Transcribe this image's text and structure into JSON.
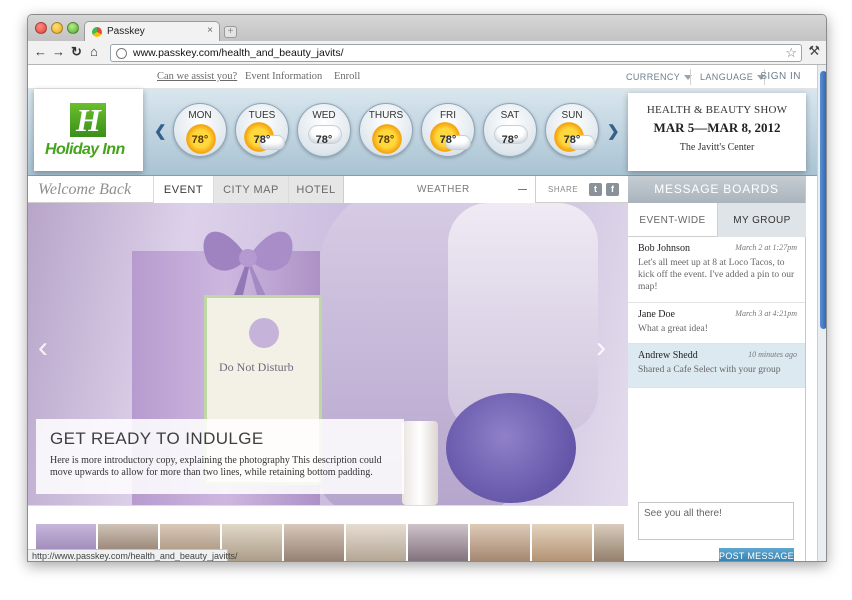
{
  "browser": {
    "tab_title": "Passkey",
    "tab_close": "×",
    "new_tab": "+",
    "url": "www.passkey.com/health_and_beauty_javits/",
    "status_url": "http://www.passkey.com/health_and_beauty_javitts/"
  },
  "nav": {
    "assist": "Can we assist you?",
    "event_info": "Event Information",
    "enroll": "Enroll",
    "currency": "CURRENCY",
    "language": "LANGUAGE",
    "sign_in": "SIGN IN"
  },
  "brand": {
    "logo_text": "Holiday Inn",
    "logo_mark": "H",
    "color": "#45a31c"
  },
  "weather": {
    "days": [
      {
        "day": "MON",
        "temp": "78°",
        "icon": "sun-icon"
      },
      {
        "day": "TUES",
        "temp": "78°",
        "icon": "sun-cloud-icon"
      },
      {
        "day": "WED",
        "temp": "78°",
        "icon": "cloud-icon"
      },
      {
        "day": "THURS",
        "temp": "78°",
        "icon": "sun-icon"
      },
      {
        "day": "FRI",
        "temp": "78°",
        "icon": "sun-cloud-icon"
      },
      {
        "day": "SAT",
        "temp": "78°",
        "icon": "cloud-icon"
      },
      {
        "day": "SUN",
        "temp": "78°",
        "icon": "sun-cloud-icon"
      }
    ]
  },
  "show": {
    "title": "HEALTH & BEAUTY SHOW",
    "dates": "MAR 5—MAR 8, 2012",
    "venue": "The Javitt's Center"
  },
  "section": {
    "welcome": "Welcome Back",
    "tabs": [
      "EVENT",
      "CITY MAP",
      "HOTEL"
    ],
    "weather": "WEATHER",
    "share": "SHARE",
    "twitter": "t",
    "facebook": "f"
  },
  "hero": {
    "title": "GET READY TO INDULGE",
    "body": "Here is more introductory copy, explaining the photography This description could move upwards to allow for more than two lines, while retaining bottom padding.",
    "sign_text": "Do Not Disturb",
    "prev": "‹",
    "next": "›"
  },
  "messages": {
    "title": "MESSAGE BOARDS",
    "tabs": [
      "EVENT-WIDE",
      "MY GROUP"
    ],
    "posts": [
      {
        "name": "Bob Johnson",
        "time": "March 2 at 1:27pm",
        "text": "Let's all meet up at 8 at Loco Tacos, to kick off the event. I've added a pin to our map!"
      },
      {
        "name": "Jane Doe",
        "time": "March 3 at 4:21pm",
        "text": "What a great idea!"
      },
      {
        "name": "Andrew Shedd",
        "time": "10 minutes ago",
        "text": "Shared a Cafe Select with your group"
      }
    ],
    "input_value": "See you all there!",
    "post_button": "POST MESSAGE"
  }
}
